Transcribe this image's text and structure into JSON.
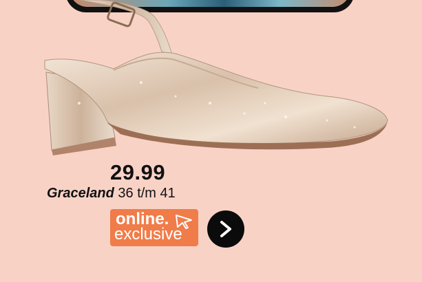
{
  "product": {
    "price": "29.99",
    "brand": "Graceland",
    "size_range": "36 t/m 41"
  },
  "badge": {
    "line1": "online.",
    "line2": "exclusive",
    "icon": "cursor-arrow-icon"
  },
  "action": {
    "icon": "chevron-right-icon",
    "color": "#0b0b0b"
  },
  "colors": {
    "background": "#f9d2c6",
    "badge": "#f07c4a",
    "shoe": "#e6d2bf"
  }
}
